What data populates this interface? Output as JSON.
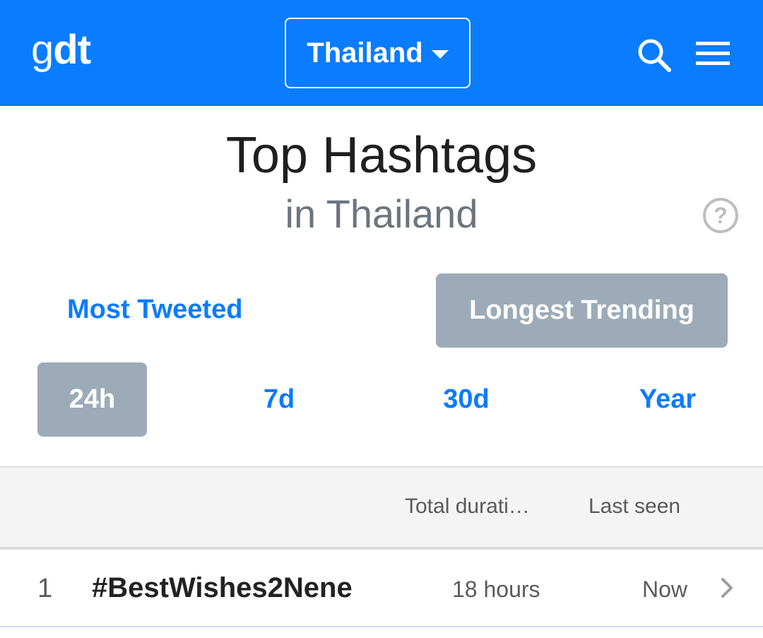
{
  "header": {
    "logo_g": "g",
    "logo_dt": "dt",
    "country": "Thailand",
    "accent_color": "#0a7cff"
  },
  "page": {
    "title": "Top Hashtags",
    "subtitle": "in Thailand"
  },
  "modes": {
    "most_tweeted": "Most Tweeted",
    "longest_trending": "Longest Trending",
    "active": "Longest Trending"
  },
  "periods": {
    "p24": "24h",
    "p7": "7d",
    "p30": "30d",
    "pyear": "Year",
    "active": "24h"
  },
  "table": {
    "headers": {
      "duration": "Total durati…",
      "last_seen": "Last seen"
    },
    "rows": [
      {
        "rank": "1",
        "hashtag": "#BestWishes2Nene",
        "duration": "18 hours",
        "last_seen": "Now"
      }
    ]
  },
  "icons": {
    "search": "search-icon",
    "menu": "menu-icon",
    "help": "help-icon",
    "caret": "caret-down-icon",
    "chevron": "chevron-right-icon"
  }
}
